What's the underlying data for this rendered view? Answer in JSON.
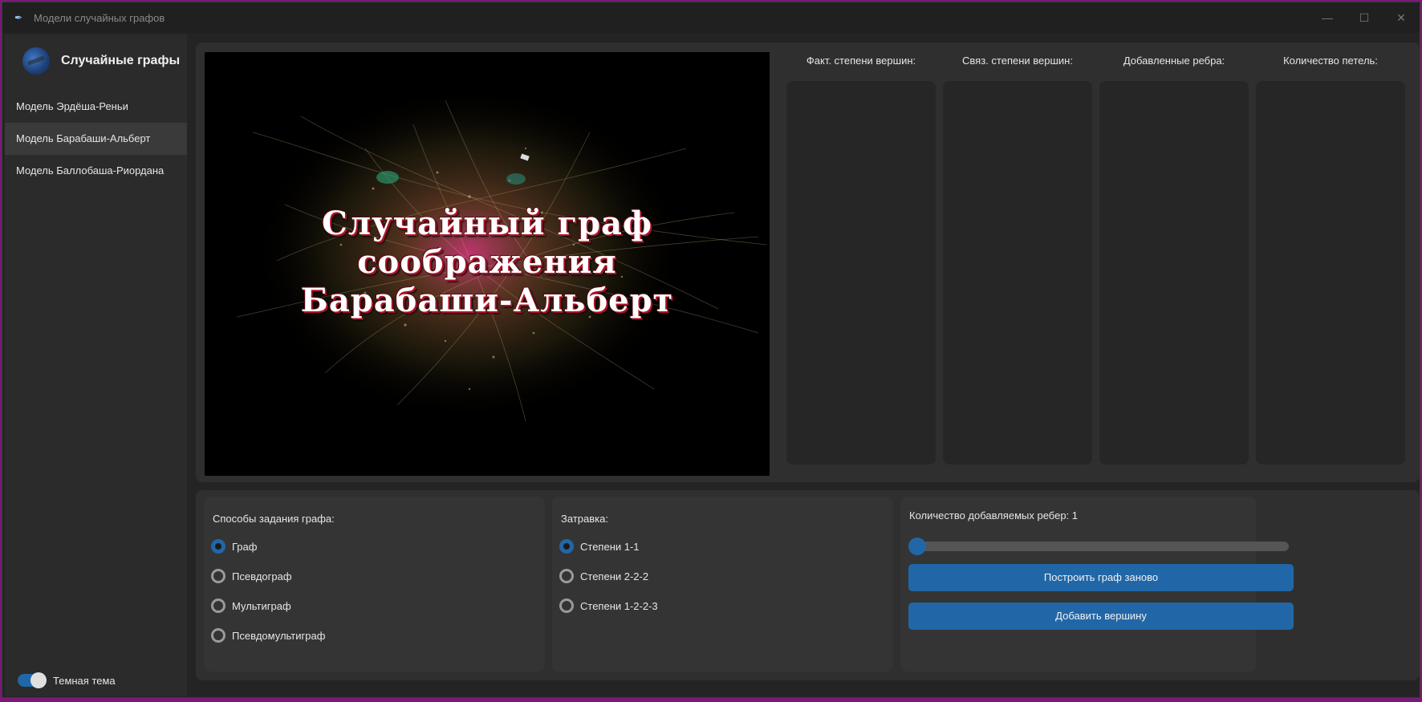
{
  "window": {
    "title": "Модели случайных графов",
    "controls": {
      "minimize": "—",
      "maximize": "☐",
      "close": "✕"
    }
  },
  "sidebar": {
    "title": "Случайные графы",
    "items": [
      {
        "label": "Модель Эрдёша-Реньи",
        "active": false
      },
      {
        "label": "Модель Барабаши-Альберт",
        "active": true
      },
      {
        "label": "Модель Баллобаша-Риордана",
        "active": false
      }
    ],
    "theme_toggle": {
      "label": "Темная тема",
      "on": true
    }
  },
  "image": {
    "caption_lines": [
      "Случайный граф",
      "соображения",
      "Барабаши-Альберт"
    ]
  },
  "stats": [
    {
      "title": "Факт. степени вершин:"
    },
    {
      "title": "Связ. степени вершин:"
    },
    {
      "title": "Добавленные ребра:"
    },
    {
      "title": "Количество петель:"
    }
  ],
  "graph_methods": {
    "title": "Способы задания графа:",
    "options": [
      {
        "label": "Граф",
        "checked": true
      },
      {
        "label": "Псевдограф",
        "checked": false
      },
      {
        "label": "Мультиграф",
        "checked": false
      },
      {
        "label": "Псевдомультиграф",
        "checked": false
      }
    ]
  },
  "seed": {
    "title": "Затравка:",
    "options": [
      {
        "label": "Степени 1-1",
        "checked": true
      },
      {
        "label": "Степени 2-2-2",
        "checked": false
      },
      {
        "label": "Степени 1-2-2-3",
        "checked": false
      }
    ]
  },
  "edges": {
    "label": "Количество добавляемых ребер: 1",
    "slider_value": 0,
    "rebuild_button": "Построить граф заново",
    "add_vertex_button": "Добавить вершину"
  },
  "colors": {
    "accent": "#2167a8",
    "background": "#242424",
    "panel": "#2f2f2f"
  }
}
